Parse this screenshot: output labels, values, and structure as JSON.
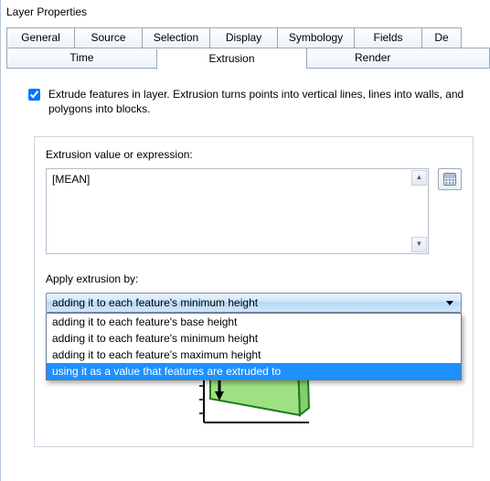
{
  "window": {
    "title": "Layer Properties"
  },
  "tabs_row1": [
    "General",
    "Source",
    "Selection",
    "Display",
    "Symbology",
    "Fields",
    "De"
  ],
  "tabs_row2": {
    "time": "Time",
    "extrusion": "Extrusion",
    "render": "Render"
  },
  "extrude_checkbox": {
    "checked": true,
    "label": "Extrude features in layer.  Extrusion turns points into vertical lines, lines into walls, and polygons into blocks."
  },
  "expression": {
    "label": "Extrusion value or expression:",
    "value": "[MEAN]"
  },
  "calc_button": {
    "name": "expression-builder"
  },
  "apply_by": {
    "label": "Apply extrusion by:",
    "selected": "adding it to each feature's minimum height",
    "options": [
      "adding it to each feature's base height",
      "adding it to each feature's minimum height",
      "adding it to each feature's maximum height",
      "using it as a value that features are extruded to"
    ],
    "highlighted_index": 3
  }
}
